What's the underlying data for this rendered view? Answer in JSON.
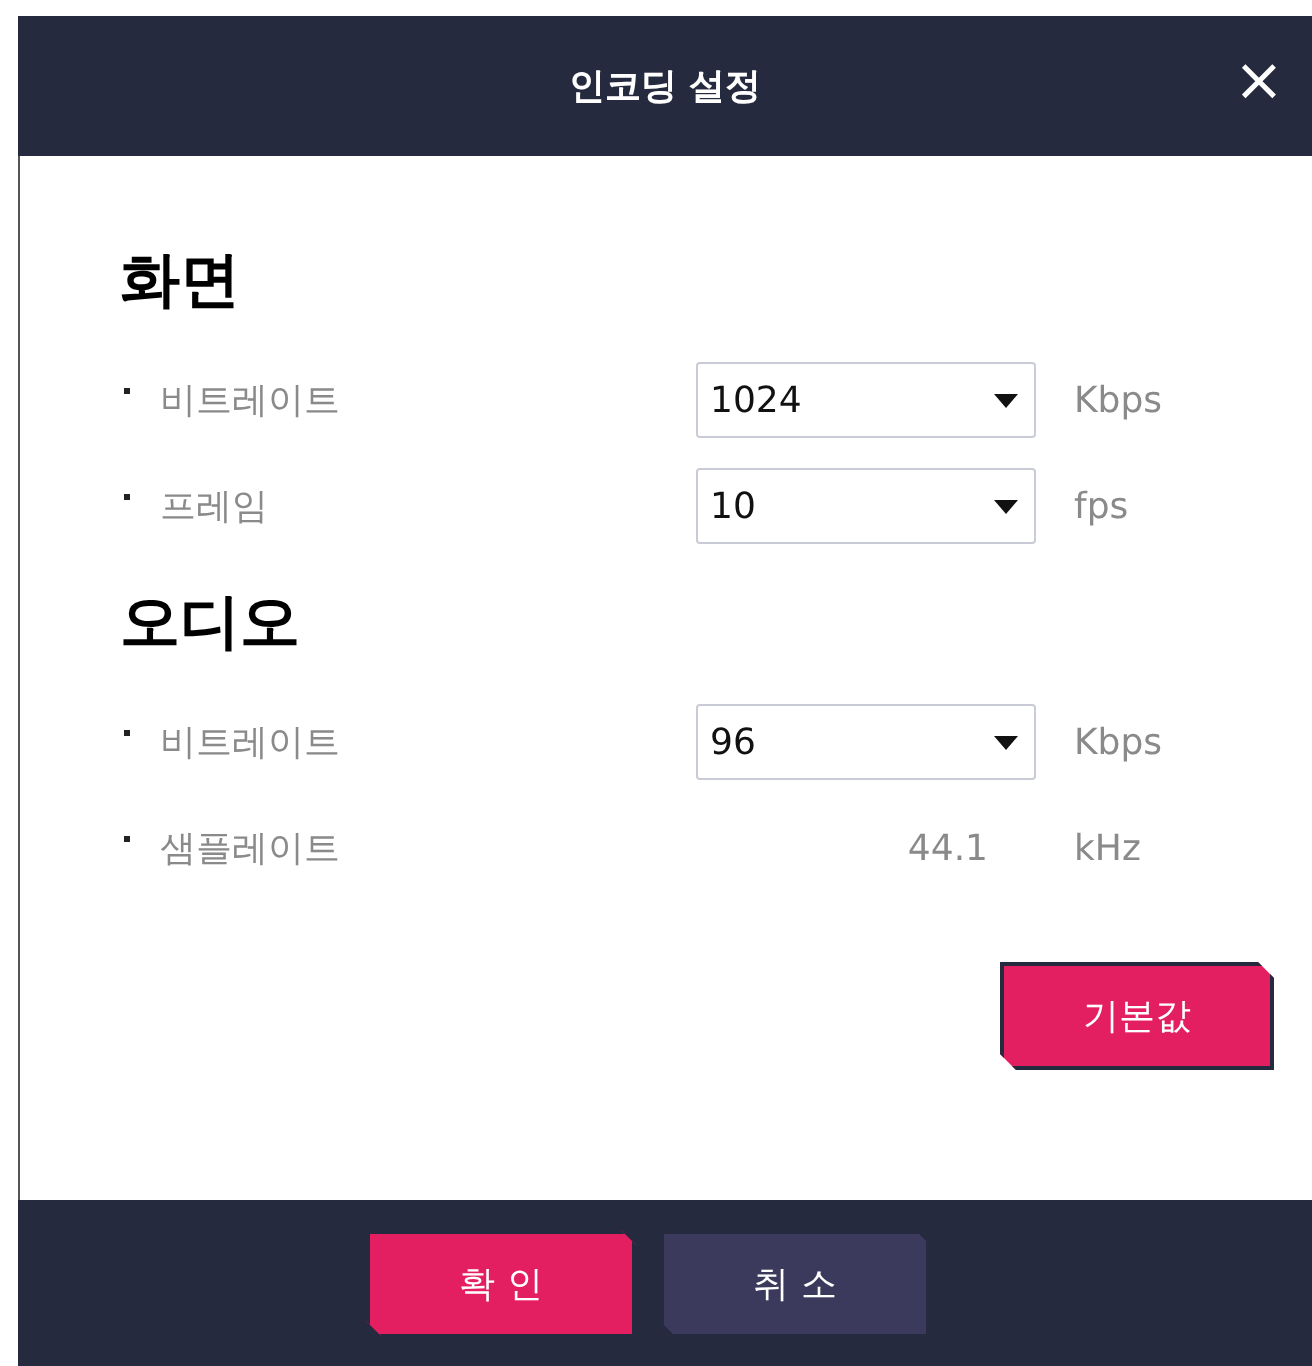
{
  "window": {
    "title": "인코딩 설정",
    "close": "×"
  },
  "sections": [
    {
      "heading": "화면",
      "rows": [
        {
          "kind": "select",
          "label": "비트레이트",
          "value": "1024",
          "unit": "Kbps"
        },
        {
          "kind": "select",
          "label": "프레임",
          "value": "10",
          "unit": "fps"
        }
      ]
    },
    {
      "heading": "오디오",
      "rows": [
        {
          "kind": "select",
          "label": "비트레이트",
          "value": "96",
          "unit": "Kbps"
        },
        {
          "kind": "static",
          "label": "샘플레이트",
          "value": "44.1",
          "unit": "kHz"
        }
      ]
    }
  ],
  "default_button": "기본값",
  "footer_buttons": [
    {
      "label": "확 인",
      "kind": "primary"
    },
    {
      "label": "취 소",
      "kind": "secondary"
    }
  ]
}
